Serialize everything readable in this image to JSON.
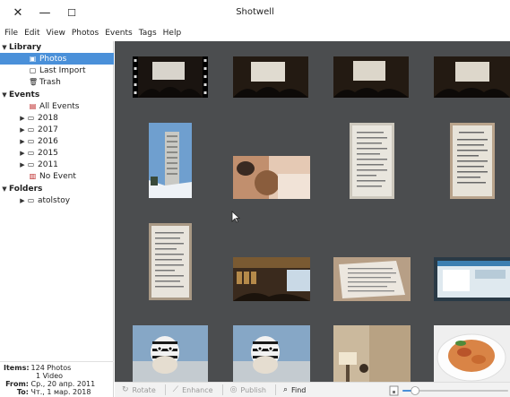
{
  "window": {
    "title": "Shotwell",
    "close_glyph": "✕",
    "minimize_glyph": "—",
    "maximize_glyph": "☐"
  },
  "menu": [
    "File",
    "Edit",
    "View",
    "Photos",
    "Events",
    "Tags",
    "Help"
  ],
  "sidebar": {
    "library": {
      "label": "Library",
      "items": [
        {
          "label": "Photos",
          "icon": "photos-icon",
          "selected": true
        },
        {
          "label": "Last Import",
          "icon": "import-icon"
        },
        {
          "label": "Trash",
          "icon": "trash-icon"
        }
      ]
    },
    "events": {
      "label": "Events",
      "all": "All Events",
      "years": [
        "2018",
        "2017",
        "2016",
        "2015",
        "2011"
      ],
      "no_event": "No Event"
    },
    "folders": {
      "label": "Folders",
      "items": [
        "atolstoy"
      ]
    },
    "stats": {
      "items_label": "Items:",
      "items_value": "124 Photos",
      "items_value2": "1 Video",
      "from_label": "From:",
      "from_value": "Ср., 20 апр. 2011",
      "to_label": "To:",
      "to_value": "Чт., 1 мар. 2018"
    }
  },
  "toolbar": {
    "rotate": "Rotate",
    "enhance": "Enhance",
    "publish": "Publish",
    "find": "Find"
  },
  "zoom_level": 0.12,
  "colors": {
    "selection": "#4a90d9",
    "gallery_bg": "#4b4d4f"
  },
  "thumbnails": [
    {
      "kind": "presentation-photo"
    },
    {
      "kind": "presentation-photo"
    },
    {
      "kind": "presentation-photo"
    },
    {
      "kind": "presentation-photo"
    },
    {
      "kind": "building-photo"
    },
    {
      "kind": "hand-photo"
    },
    {
      "kind": "document-photo"
    },
    {
      "kind": "document-photo"
    },
    {
      "kind": "document-photo"
    },
    {
      "kind": "bookstore-photo"
    },
    {
      "kind": "paper-photo"
    },
    {
      "kind": "screen-photo"
    },
    {
      "kind": "toy-zebra-photo"
    },
    {
      "kind": "toy-zebra-photo"
    },
    {
      "kind": "room-photo"
    },
    {
      "kind": "food-photo"
    }
  ]
}
